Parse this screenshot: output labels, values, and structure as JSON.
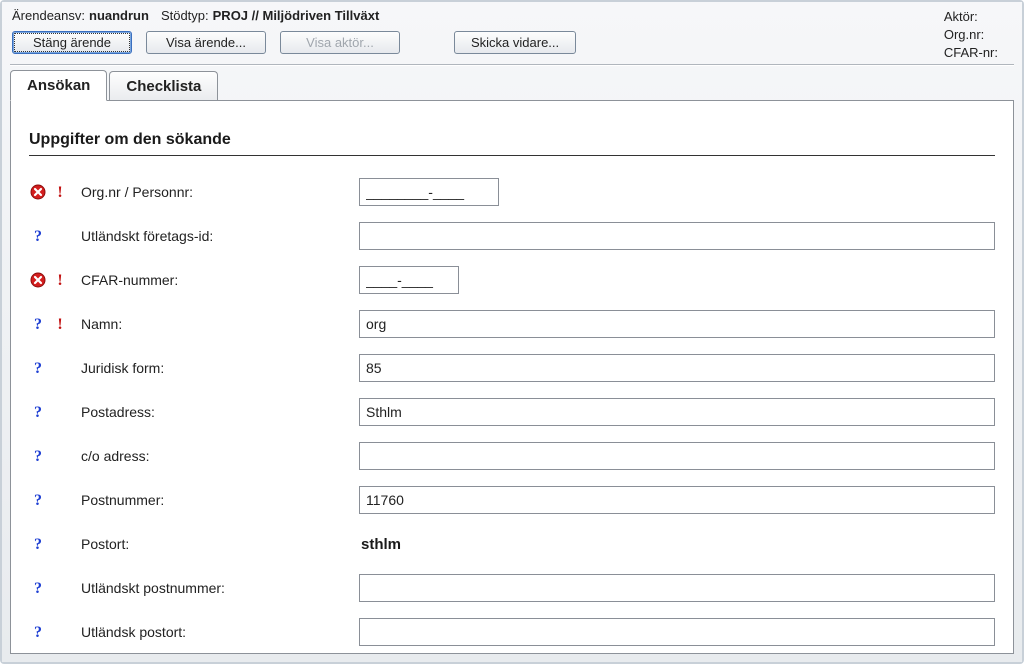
{
  "header": {
    "labels": {
      "arendeansv": "Ärendeansv:",
      "stodtyp": "Stödtyp:",
      "aktor": "Aktör:",
      "orgnr": "Org.nr:",
      "cfarnr": "CFAR-nr:"
    },
    "values": {
      "arendeansv": "nuandrun",
      "stodtyp": "PROJ // Miljödriven Tillväxt",
      "aktor": "",
      "orgnr": "",
      "cfarnr": ""
    }
  },
  "toolbar": {
    "close": "Stäng ärende",
    "show_case": "Visa ärende...",
    "show_actor": "Visa aktör...",
    "forward": "Skicka vidare..."
  },
  "tabs": {
    "ansokan": "Ansökan",
    "checklista": "Checklista"
  },
  "section": {
    "title": "Uppgifter om den sökande"
  },
  "fields": [
    {
      "key": "orgnr_personnr",
      "label": "Org.nr / Personnr:",
      "value": "________-____",
      "input": true,
      "short": "short1",
      "icons": [
        "error",
        "bang"
      ]
    },
    {
      "key": "utl_foretags_id",
      "label": "Utländskt företags-id:",
      "value": "",
      "input": true,
      "icons": [
        "help"
      ]
    },
    {
      "key": "cfar_nummer",
      "label": "CFAR-nummer:",
      "value": "____-____",
      "input": true,
      "short": "short2",
      "icons": [
        "error",
        "bang"
      ]
    },
    {
      "key": "namn",
      "label": "Namn:",
      "value": "org",
      "input": true,
      "icons": [
        "help",
        "bang"
      ]
    },
    {
      "key": "juridisk_form",
      "label": "Juridisk form:",
      "value": "85",
      "input": true,
      "icons": [
        "help"
      ]
    },
    {
      "key": "postadress",
      "label": "Postadress:",
      "value": "Sthlm",
      "input": true,
      "icons": [
        "help"
      ]
    },
    {
      "key": "co_adress",
      "label": "c/o adress:",
      "value": "",
      "input": true,
      "icons": [
        "help"
      ]
    },
    {
      "key": "postnummer",
      "label": "Postnummer:",
      "value": "11760",
      "input": true,
      "icons": [
        "help"
      ]
    },
    {
      "key": "postort",
      "label": "Postort:",
      "value": "sthlm",
      "input": false,
      "icons": [
        "help"
      ]
    },
    {
      "key": "utl_postnummer",
      "label": "Utländskt postnummer:",
      "value": "",
      "input": true,
      "icons": [
        "help"
      ]
    },
    {
      "key": "utl_postort",
      "label": "Utländsk postort:",
      "value": "",
      "input": true,
      "icons": [
        "help"
      ]
    }
  ]
}
